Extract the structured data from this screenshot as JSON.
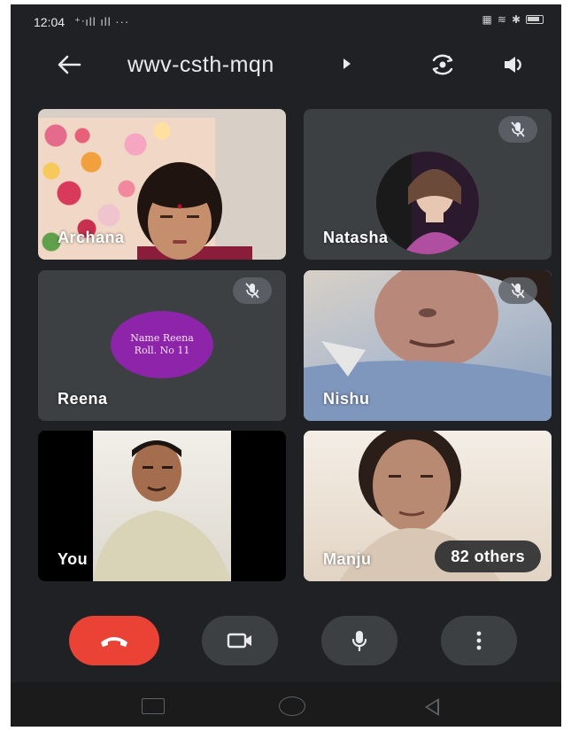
{
  "status_bar": {
    "time": "12:04",
    "signal": "⁺ᐧıll ıll ···",
    "right_icons": [
      "volte-icon",
      "wifi-icon",
      "bluetooth-icon",
      "battery-icon"
    ]
  },
  "header": {
    "meeting_code": "wwv-csth-mqn",
    "icons": [
      "back-arrow-icon",
      "caret-right-icon",
      "switch-camera-icon",
      "speaker-icon"
    ]
  },
  "participants": [
    {
      "name": "Archana",
      "muted": false,
      "video": true
    },
    {
      "name": "Natasha",
      "muted": true,
      "video": false
    },
    {
      "name": "Reena",
      "muted": true,
      "video": false,
      "avatar_text_line1": "Name Reena",
      "avatar_text_line2": "Roll. No 11",
      "avatar_color": "#8e24aa"
    },
    {
      "name": "Nishu",
      "muted": true,
      "video": true
    },
    {
      "name": "You",
      "muted": false,
      "video": true
    },
    {
      "name": "Manju",
      "muted": false,
      "video": true
    }
  ],
  "others_badge": "82 others",
  "controls": {
    "end_call_color": "#ea4335",
    "icons": [
      "end-call-icon",
      "camera-icon",
      "mic-icon",
      "more-vert-icon"
    ]
  },
  "nav": {
    "icons": [
      "recent-apps-icon",
      "home-icon",
      "back-icon"
    ]
  },
  "colors": {
    "background": "#202124",
    "tile": "#3c4043",
    "text": "#e8eaed"
  }
}
